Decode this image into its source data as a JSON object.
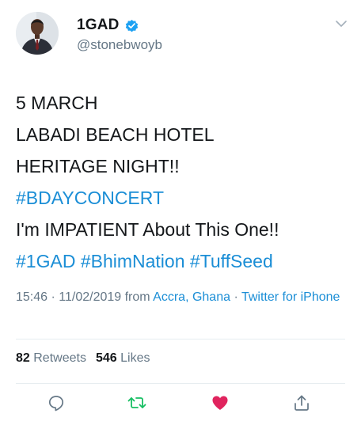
{
  "user": {
    "display_name": "1GAD",
    "handle": "@stonebwoyb",
    "verified": true
  },
  "tweet": {
    "lines": [
      "5 MARCH",
      "LABADI BEACH HOTEL",
      "HERITAGE NIGHT!!",
      "#BDAYCONCERT",
      "I'm IMPATIENT About This One!!",
      "#1GAD #BhimNation #TuffSeed"
    ],
    "time": "15:46",
    "date_sep": " · ",
    "date": "11/02/2019",
    "from_text": " from ",
    "location": "Accra, Ghana",
    "source_sep": " · ",
    "source": "Twitter for iPhone"
  },
  "stats": {
    "retweets_count": "82",
    "retweets_label": "Retweets",
    "likes_count": "546",
    "likes_label": "Likes"
  },
  "actions": {
    "reply": "reply-icon",
    "retweet": "retweet-icon",
    "like": "heart-icon",
    "share": "share-icon"
  },
  "colors": {
    "text": "#14171a",
    "muted": "#657786",
    "link": "#1b8ed6",
    "verified": "#1da1f2",
    "retweet": "#17bf63",
    "like": "#e0245e",
    "divider": "#e6ecf0"
  }
}
